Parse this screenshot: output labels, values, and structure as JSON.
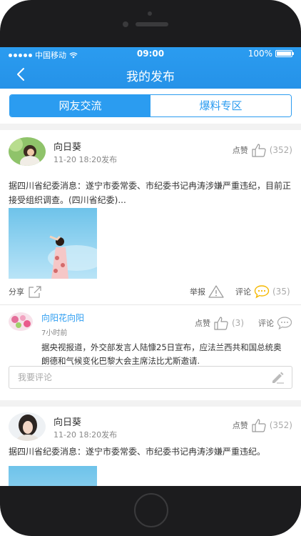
{
  "status_bar": {
    "carrier": "中国移动",
    "time": "09:00",
    "battery": "100%"
  },
  "nav": {
    "title": "我的发布",
    "back_icon": "chevron-left-icon"
  },
  "tabs": [
    {
      "label": "网友交流",
      "active": true
    },
    {
      "label": "爆料专区",
      "active": false
    }
  ],
  "posts": [
    {
      "author": "向日葵",
      "time": "11-20 18:20发布",
      "like_label": "点赞",
      "like_count": "(352)",
      "text": "据四川省纪委消息：遂宁市委常委、市纪委书记冉涛涉嫌严重违纪，目前正接受组织调查。(四川省纪委)...",
      "share_label": "分享",
      "report_label": "举报",
      "comment_label": "评论",
      "comment_count": "(35)",
      "comments": [
        {
          "author": "向阳花向阳",
          "time": "7小时前",
          "like_label": "点赞",
          "like_count": "(3)",
          "comment_label": "评论",
          "text": "据央视报道，外交部发言人陆慷25日宣布，应法兰西共和国总统奥朗德和气候变化巴黎大会主席法比尤斯邀请."
        }
      ],
      "comment_input_placeholder": "我要评论"
    },
    {
      "author": "向日葵",
      "time": "11-20 18:20发布",
      "like_label": "点赞",
      "like_count": "(352)",
      "text": "据四川省纪委消息：遂宁市委常委、市纪委书记冉涛涉嫌严重违纪。"
    }
  ],
  "colors": {
    "accent": "#2b9cf0",
    "like_active": "#f5b800",
    "background_gap": "#f2f2f2"
  }
}
